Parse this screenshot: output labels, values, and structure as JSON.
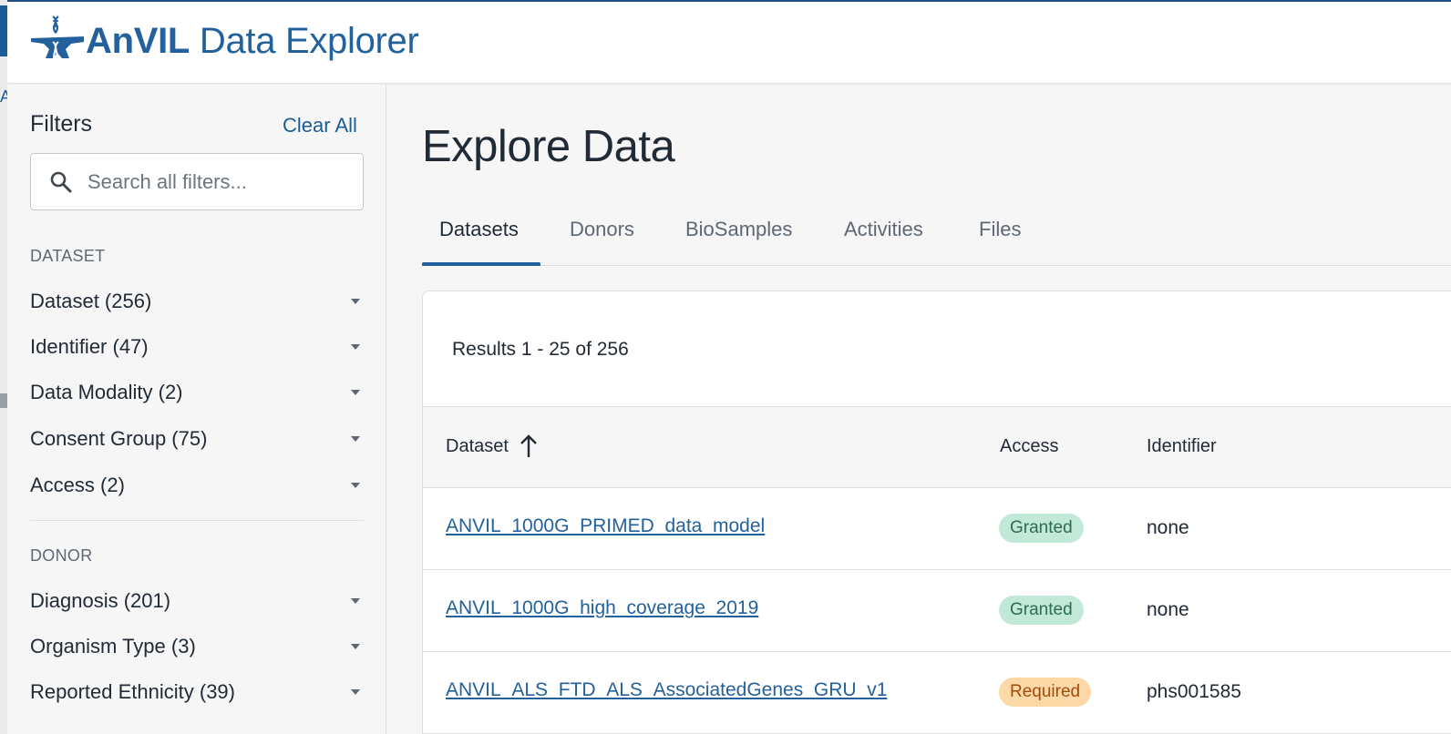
{
  "app": {
    "title_bold": "AnVIL",
    "title_rest": " Data Explorer",
    "brand_color": "#23619c"
  },
  "sidebar": {
    "title": "Filters",
    "clear_all": "Clear All",
    "search": {
      "placeholder": "Search all filters...",
      "value": ""
    },
    "sections": [
      {
        "label": "DATASET",
        "facets": [
          {
            "label": "Dataset (256)"
          },
          {
            "label": "Identifier (47)"
          },
          {
            "label": "Data Modality (2)"
          },
          {
            "label": "Consent Group (75)"
          },
          {
            "label": "Access (2)"
          }
        ]
      },
      {
        "label": "DONOR",
        "facets": [
          {
            "label": "Diagnosis (201)"
          },
          {
            "label": "Organism Type (3)"
          },
          {
            "label": "Reported Ethnicity (39)"
          }
        ]
      }
    ]
  },
  "main": {
    "title": "Explore Data",
    "tabs": [
      {
        "label": "Datasets",
        "active": true
      },
      {
        "label": "Donors"
      },
      {
        "label": "BioSamples"
      },
      {
        "label": "Activities"
      },
      {
        "label": "Files"
      }
    ],
    "results_text": "Results 1 - 25 of 256",
    "columns": [
      "Dataset",
      "Access",
      "Identifier"
    ],
    "rows": [
      {
        "dataset": "ANVIL_1000G_PRIMED_data_model",
        "access": "Granted",
        "identifier": "none"
      },
      {
        "dataset": "ANVIL_1000G_high_coverage_2019",
        "access": "Granted",
        "identifier": "none"
      },
      {
        "dataset": "ANVIL_ALS_FTD_ALS_AssociatedGenes_GRU_v1",
        "access": "Required",
        "identifier": "phs001585"
      }
    ],
    "status_colors": {
      "granted_bg": "#c2e9d7",
      "required_bg": "#fed9a8"
    }
  }
}
